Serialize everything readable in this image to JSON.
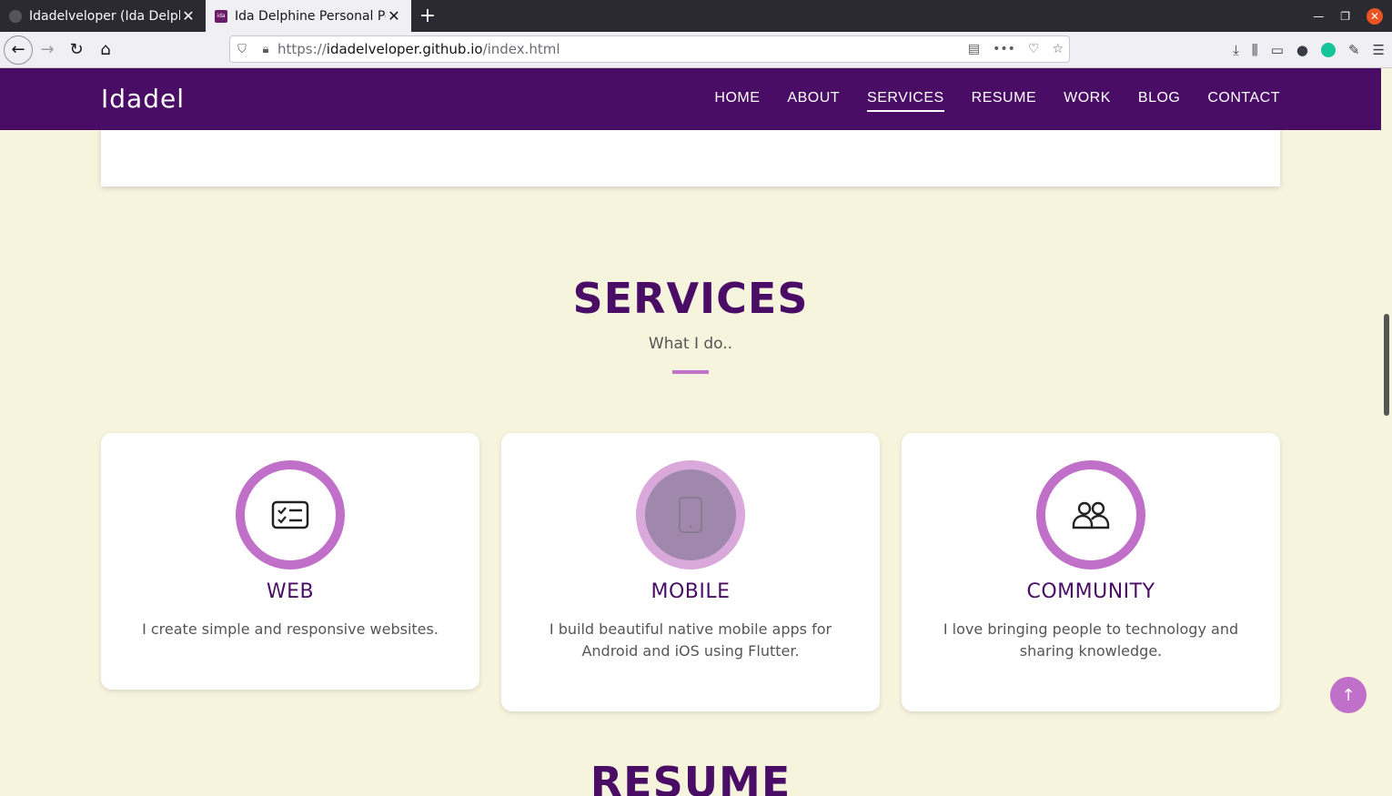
{
  "browser": {
    "tabs": [
      {
        "title": "Idadelveloper (Ida Delph"
      },
      {
        "title": "Ida Delphine Personal Po"
      }
    ],
    "favicon_ida": "ida",
    "url": {
      "proto": "https://",
      "host": "idadelveloper.github.io",
      "path": "/index.html"
    }
  },
  "site": {
    "brand": "Idadel",
    "menu": [
      "HOME",
      "ABOUT",
      "SERVICES",
      "RESUME",
      "WORK",
      "BLOG",
      "CONTACT"
    ],
    "active_menu": "SERVICES"
  },
  "services": {
    "title": "SERVICES",
    "subtitle": "What I do..",
    "cards": [
      {
        "icon": "checklist-icon",
        "title": "WEB",
        "text": "I create simple and responsive websites."
      },
      {
        "icon": "mobile-phone-icon",
        "title": "MOBILE",
        "text": "I build beautiful native mobile apps for Android and iOS using Flutter."
      },
      {
        "icon": "people-icon",
        "title": "COMMUNITY",
        "text": "I love bringing people to technology and sharing knowledge."
      }
    ]
  },
  "resume": {
    "title": "RESUME"
  },
  "colors": {
    "nav": "#4a0d66",
    "accent": "#c070c8",
    "page_bg": "#f7f4de"
  }
}
